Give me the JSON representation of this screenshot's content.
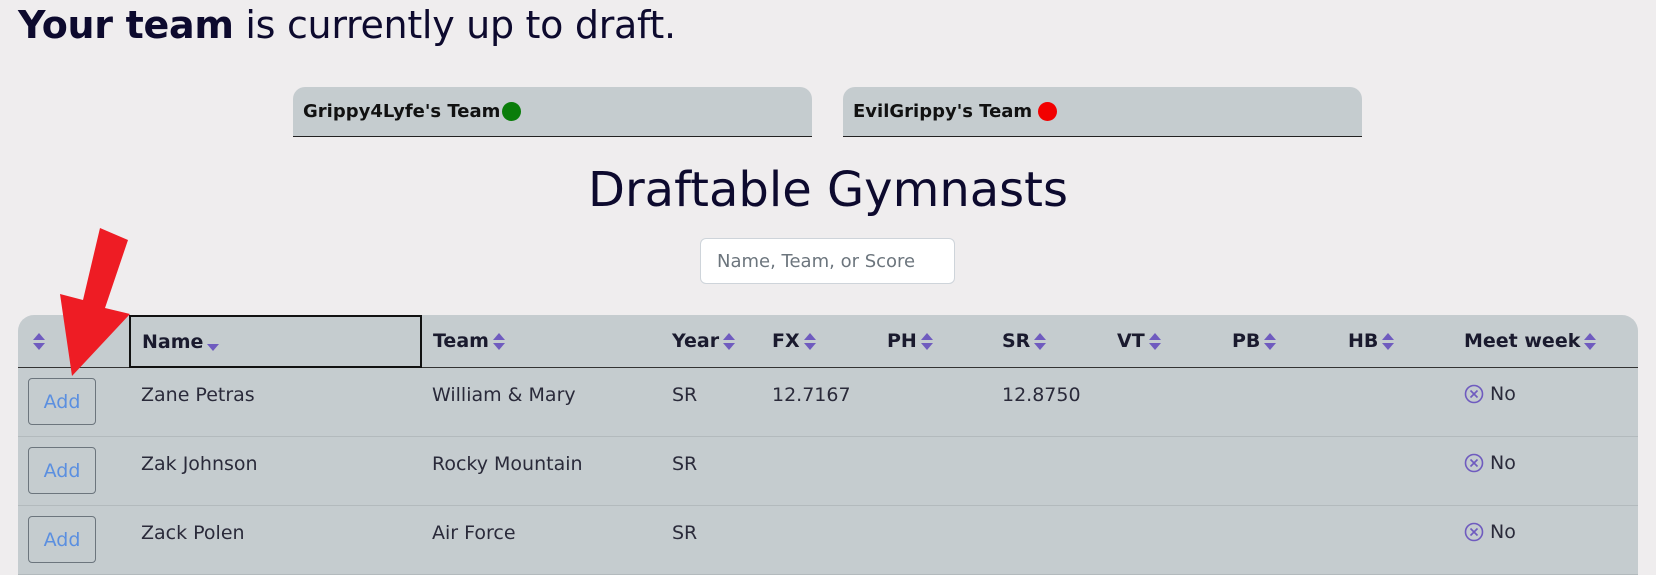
{
  "headline": {
    "bold": "Your team",
    "rest": " is currently up to draft."
  },
  "teams": [
    {
      "name": "Grippy4Lyfe's Team",
      "status_color": "#0a7d0a"
    },
    {
      "name": "EvilGrippy's Team",
      "status_color": "#f20000"
    }
  ],
  "section_title": "Draftable Gymnasts",
  "search": {
    "placeholder": "Name, Team, or Score",
    "value": ""
  },
  "table": {
    "columns": [
      "",
      "Name",
      "Team",
      "Year",
      "FX",
      "PH",
      "SR",
      "VT",
      "PB",
      "HB",
      "Meet week"
    ],
    "rows": [
      {
        "action": "Add",
        "name": "Zane Petras",
        "team": "William & Mary",
        "year": "SR",
        "fx": "12.7167",
        "ph": "",
        "sr": "12.8750",
        "vt": "",
        "pb": "",
        "hb": "",
        "meet_week": "No"
      },
      {
        "action": "Add",
        "name": "Zak Johnson",
        "team": "Rocky Mountain",
        "year": "SR",
        "fx": "",
        "ph": "",
        "sr": "",
        "vt": "",
        "pb": "",
        "hb": "",
        "meet_week": "No"
      },
      {
        "action": "Add",
        "name": "Zack Polen",
        "team": "Air Force",
        "year": "SR",
        "fx": "",
        "ph": "",
        "sr": "",
        "vt": "",
        "pb": "",
        "hb": "",
        "meet_week": "No"
      }
    ]
  },
  "colors": {
    "sort_icon": "#6f5bbf",
    "arrow": "#ee1c24",
    "add_text": "#5b8fe0"
  }
}
